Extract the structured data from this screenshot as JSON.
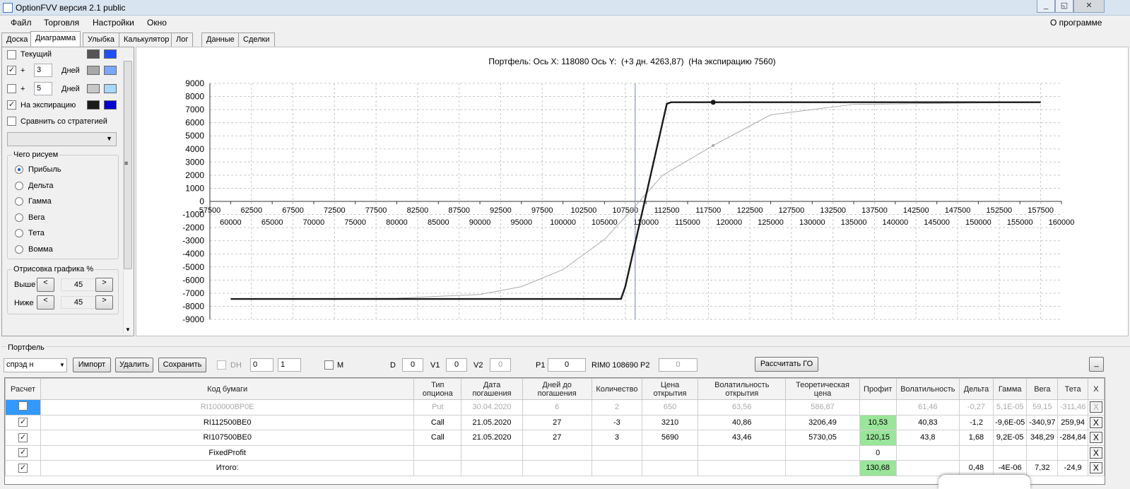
{
  "window": {
    "title": "OptionFVV версия 2.1 public",
    "minimize": "_",
    "maximize": "◱",
    "close": "✕"
  },
  "menu": [
    "Файл",
    "Торговля",
    "Настройки",
    "Окно"
  ],
  "menu_right": "О программе",
  "tabs": [
    "Доска",
    "Диаграмма",
    "Улыбка",
    "Калькулятор",
    "Лог",
    "Данные",
    "Сделки"
  ],
  "left": {
    "current_label": "Текущий",
    "plus": "+",
    "days_label": "Дней",
    "days1": "3",
    "days2": "5",
    "expiry_label": "На экспирацию",
    "compare_label": "Сравнить со стратегией",
    "draw_group": "Чего рисуем",
    "draw_options": [
      "Прибыль",
      "Дельта",
      "Гамма",
      "Вега",
      "Тета",
      "Вомма"
    ],
    "render_group": "Отрисовка графика %",
    "above_label": "Выше",
    "below_label": "Ниже",
    "above_value": "45",
    "below_value": "45",
    "dec": "<",
    "inc": ">",
    "colors": {
      "current": [
        "#555555",
        "#1f4fff"
      ],
      "days1": [
        "#a8a8a8",
        "#7aa7ff"
      ],
      "days2": [
        "#c8c8c8",
        "#a8d8ff"
      ],
      "expiry": [
        "#1a1a1a",
        "#0000d0"
      ]
    }
  },
  "chart_data": {
    "type": "line",
    "title": "Портфель: Ось X: 118080 Ось Y:  (+3 дн. 4263,87)  (На экспирацию 7560)",
    "yticks": [
      "9000",
      "8000",
      "7000",
      "6000",
      "5000",
      "4000",
      "3000",
      "2000",
      "1000",
      "0",
      "-1000",
      "-2000",
      "-3000",
      "-4000",
      "-5000",
      "-6000",
      "-7000",
      "-8000",
      "-9000"
    ],
    "xticks_upper": [
      "57500",
      "62500",
      "67500",
      "72500",
      "77500",
      "82500",
      "87500",
      "92500",
      "97500",
      "102500",
      "107500",
      "112500",
      "117500",
      "122500",
      "127500",
      "132500",
      "137500",
      "142500",
      "147500",
      "152500",
      "157500"
    ],
    "xticks_lower": [
      "60000",
      "65000",
      "70000",
      "75000",
      "80000",
      "85000",
      "90000",
      "95000",
      "100000",
      "105000",
      "110000",
      "115000",
      "120000",
      "125000",
      "130000",
      "135000",
      "140000",
      "145000",
      "150000",
      "155000",
      "160000"
    ],
    "xlim": [
      57500,
      160000
    ],
    "ylim": [
      -9000,
      9000
    ],
    "grid": true,
    "cursor_x": 108690,
    "series": [
      {
        "color": "#1a1a1a",
        "x": [
          60000,
          106990,
          107500,
          112500,
          113000,
          157500
        ],
        "y": [
          -7440,
          -7440,
          -6500,
          7440,
          7560,
          7560
        ]
      },
      {
        "color": "#aaaaaa",
        "x": [
          60000,
          80000,
          90000,
          95000,
          100000,
          105000,
          108500,
          112000,
          118080,
          125000,
          135000,
          157500
        ],
        "y": [
          -7440,
          -7380,
          -7100,
          -6500,
          -5200,
          -2900,
          -500,
          2000,
          4263.87,
          6600,
          7400,
          7560
        ]
      }
    ],
    "markers": [
      {
        "x": 118080,
        "y": 7560,
        "color": "#1a1a1a"
      },
      {
        "x": 118080,
        "y": 4263.87,
        "color": "#aaaaaa"
      }
    ]
  },
  "portfolio": {
    "group": "Портфель",
    "select": "спрэд н",
    "import": "Импорт",
    "delete": "Удалить",
    "save": "Сохранить",
    "dh": "DH",
    "dh1": "0",
    "dh2": "1",
    "m": "M",
    "d_label": "D",
    "d": "0",
    "v1_label": "V1",
    "v1": "0",
    "v2_label": "V2",
    "v2": "0",
    "p1_label": "P1",
    "p1": "0",
    "rim": "RIM0 108690",
    "p2_label": "P2",
    "p2": "0",
    "calc_go": "Рассчитать ГО",
    "collapse": "_"
  },
  "table": {
    "headers": [
      "Расчет",
      "Код бумаги",
      "Тип опциона",
      "Дата погашения",
      "Дней до погашения",
      "Количество",
      "Цена открытия",
      "Волатильность открытия",
      "Теоретическая цена",
      "Профит",
      "Волатильность",
      "Дельта",
      "Гамма",
      "Вега",
      "Тета",
      "X"
    ],
    "rows": [
      [
        "",
        "RI100000BP0E",
        "Put",
        "30.04.2020",
        "6",
        "2",
        "650",
        "63,56",
        "586,87",
        "",
        "61,46",
        "-0,27",
        "5,1E-05",
        "59,15",
        "-311,46",
        "X"
      ],
      [
        "✓",
        "RI112500BE0",
        "Call",
        "21.05.2020",
        "27",
        "-3",
        "3210",
        "40,86",
        "3206,49",
        "10,53",
        "40,83",
        "-1,2",
        "-9,6E-05",
        "-340,97",
        "259,94",
        "X"
      ],
      [
        "✓",
        "RI107500BE0",
        "Call",
        "21.05.2020",
        "27",
        "3",
        "5690",
        "43,46",
        "5730,05",
        "120,15",
        "43,8",
        "1,68",
        "9,2E-05",
        "348,29",
        "-284,84",
        "X"
      ],
      [
        "✓",
        "FixedProfit",
        "",
        "",
        "",
        "",
        "",
        "",
        "",
        "0",
        "",
        "",
        "",
        "",
        "",
        "X"
      ],
      [
        "✓",
        "Итого:",
        "",
        "",
        "",
        "",
        "",
        "",
        "",
        "130,68",
        "",
        "0,48",
        "-4E-06",
        "7,32",
        "-24,9",
        "X"
      ]
    ]
  }
}
